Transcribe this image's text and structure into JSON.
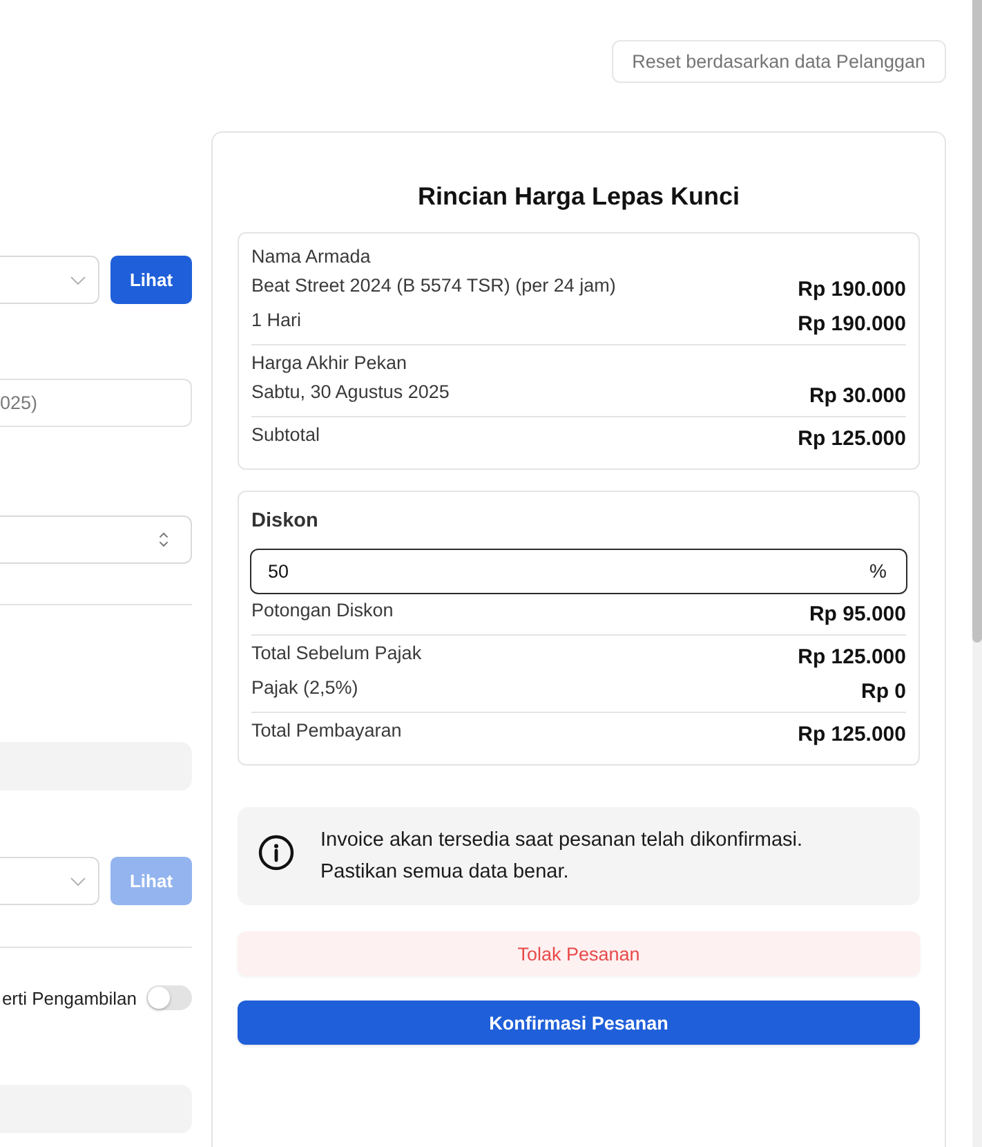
{
  "left_form": {
    "rows": [
      {
        "kind": "select-button",
        "button": {
          "label": "Lihat",
          "disabled": false
        }
      },
      {
        "kind": "input",
        "value": "025)"
      },
      {
        "kind": "stepper-select"
      },
      {
        "kind": "divider"
      },
      {
        "kind": "filled-input"
      },
      {
        "kind": "select-button",
        "button": {
          "label": "Lihat",
          "disabled": true
        }
      },
      {
        "kind": "divider"
      },
      {
        "kind": "toggle",
        "label": "erti Pengambilan",
        "on": false
      },
      {
        "kind": "filled-input"
      }
    ]
  },
  "reset_button": {
    "label": "Reset berdasarkan data Pelanggan"
  },
  "price_card": {
    "title": "Rincian Harga Lepas Kunci",
    "breakdown": {
      "groups": [
        {
          "rows": [
            {
              "label": "Nama Armada"
            },
            {
              "label": "Beat Street 2024 (B 5574 TSR) (per 24 jam)",
              "amount": "Rp 190.000"
            },
            {
              "label": "1 Hari",
              "amount": "Rp 190.000"
            }
          ]
        },
        {
          "rows": [
            {
              "label": "Harga Akhir Pekan"
            },
            {
              "label": "Sabtu, 30 Agustus 2025",
              "amount": "Rp 30.000"
            }
          ]
        },
        {
          "rows": [
            {
              "label": "Subtotal",
              "amount": "Rp 125.000"
            }
          ]
        }
      ]
    },
    "discount": {
      "heading": "Diskon",
      "input": {
        "value": "50",
        "suffix": "%",
        "focused": true
      },
      "groups": [
        {
          "rows": [
            {
              "label": "Potongan Diskon",
              "amount": "Rp 95.000"
            }
          ]
        },
        {
          "rows": [
            {
              "label": "Total Sebelum Pajak",
              "amount": "Rp 125.000"
            },
            {
              "label": "Pajak (2,5%)",
              "amount": "Rp 0"
            }
          ]
        },
        {
          "rows": [
            {
              "label": "Total Pembayaran",
              "amount": "Rp 125.000"
            }
          ]
        }
      ]
    },
    "notice": {
      "text": "Invoice akan tersedia saat pesanan telah dikonfirmasi. Pastikan semua data benar."
    },
    "buttons": [
      {
        "kind": "danger",
        "label": "Tolak Pesanan"
      },
      {
        "kind": "primary",
        "label": "Konfirmasi Pesanan"
      }
    ]
  }
}
